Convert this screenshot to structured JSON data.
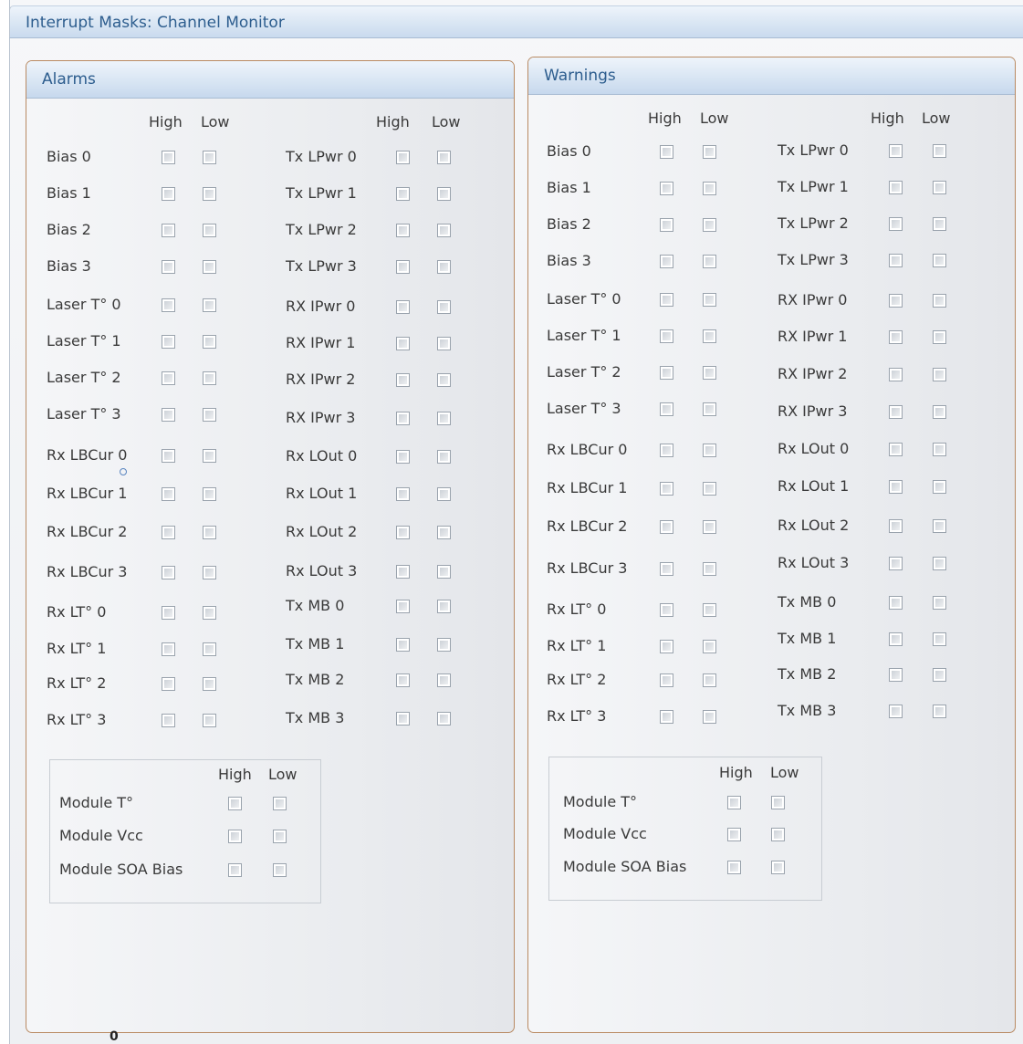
{
  "page": {
    "title": "Interrupt Masks: Channel Monitor",
    "bottom_glyph": "0"
  },
  "high_label": "High",
  "low_label": "Low",
  "alarms": {
    "title": "Alarms",
    "left_labels": [
      "Bias 0",
      "Bias 1",
      "Bias 2",
      "Bias 3",
      "Laser T° 0",
      "Laser T° 1",
      "Laser T° 2",
      "Laser T° 3",
      "Rx LBCur 0",
      "Rx LBCur 1",
      "Rx LBCur 2",
      "Rx LBCur 3",
      "Rx LT° 0",
      "Rx LT° 1",
      "Rx LT° 2",
      "Rx LT° 3"
    ],
    "right_labels": [
      "Tx LPwr 0",
      "Tx LPwr 1",
      "Tx LPwr 2",
      "Tx LPwr 3",
      "RX IPwr 0",
      "RX IPwr 1",
      "RX IPwr 2",
      "RX IPwr 3",
      "Rx LOut 0",
      "Rx LOut 1",
      "Rx LOut 2",
      "Rx LOut 3",
      "Tx MB 0",
      "Tx MB 1",
      "Tx MB 2",
      "Tx MB 3"
    ],
    "module_labels": [
      "Module T°",
      "Module Vcc",
      "Module SOA Bias"
    ]
  },
  "warnings": {
    "title": "Warnings",
    "left_labels": [
      "Bias 0",
      "Bias 1",
      "Bias 2",
      "Bias 3",
      "Laser T° 0",
      "Laser T° 1",
      "Laser T° 2",
      "Laser T° 3",
      "Rx LBCur 0",
      "Rx LBCur 1",
      "Rx LBCur 2",
      "Rx LBCur 3",
      "Rx LT° 0",
      "Rx LT° 1",
      "Rx LT° 2",
      "Rx LT° 3"
    ],
    "right_labels": [
      "Tx LPwr 0",
      "Tx LPwr 1",
      "Tx LPwr 2",
      "Tx LPwr 3",
      "RX IPwr 0",
      "RX IPwr 1",
      "RX IPwr 2",
      "RX IPwr 3",
      "Rx LOut 0",
      "Rx LOut 1",
      "Rx LOut 2",
      "Rx LOut 3",
      "Tx MB 0",
      "Tx MB 1",
      "Tx MB 2",
      "Tx MB 3"
    ],
    "module_labels": [
      "Module T°",
      "Module Vcc",
      "Module SOA Bias"
    ]
  }
}
